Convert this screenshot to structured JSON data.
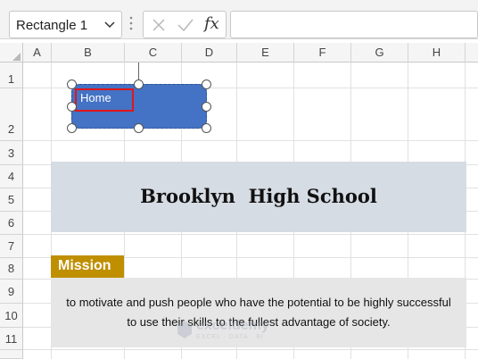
{
  "formula_bar": {
    "name_box_value": "Rectangle 1",
    "fx_label": "fx",
    "formula_value": ""
  },
  "columns": [
    "A",
    "B",
    "C",
    "D",
    "E",
    "F",
    "G",
    "H"
  ],
  "rows": [
    "1",
    "2",
    "3",
    "4",
    "5",
    "6",
    "7",
    "8",
    "9",
    "10",
    "11"
  ],
  "shape": {
    "text": "Home",
    "fill_color": "#4472c4",
    "highlight_color": "#e0161b"
  },
  "sheet": {
    "title": "Brooklyn  High School",
    "title_fill": "#d6dce4",
    "mission_label": "Mission",
    "mission_fill": "#bf8f00",
    "mission_lines": [
      "to motivate and push people who have the potential to be highly successful",
      "to use their skills to the fullest advantage of society."
    ],
    "mission_body_fill": "#e7e6e6"
  },
  "watermark": {
    "brand": "exceldemy",
    "tagline": "EXCEL · DATA · BI"
  },
  "icons": {
    "name_box_dropdown": "chevron-down-icon",
    "separator": "vertical-dots-icon",
    "cancel": "x-icon",
    "confirm": "checkmark-icon",
    "insert_function": "fx-icon",
    "select_all": "select-all-triangle-icon",
    "watermark_logo": "exceldemy-logo-icon"
  }
}
